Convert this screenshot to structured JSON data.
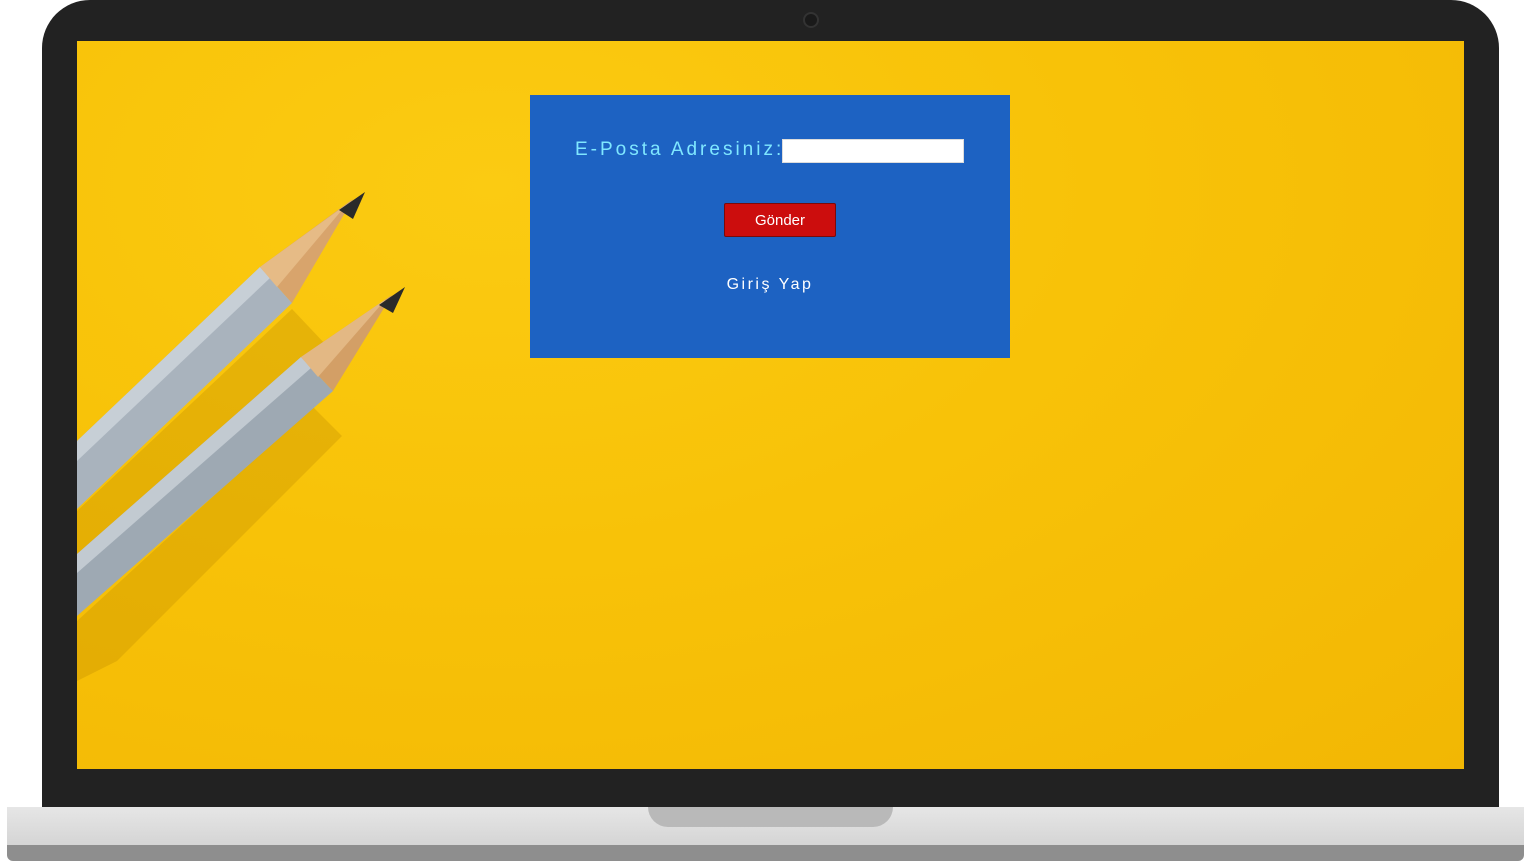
{
  "form": {
    "email_label": "E-Posta Adresiniz:",
    "email_value": "",
    "send_label": "Gönder",
    "login_link": "Giriş Yap"
  },
  "colors": {
    "panel": "#1d62c2",
    "background": "#f8c208",
    "label": "#7fe7ff",
    "button": "#cc0d0d",
    "bezel": "#222222"
  }
}
